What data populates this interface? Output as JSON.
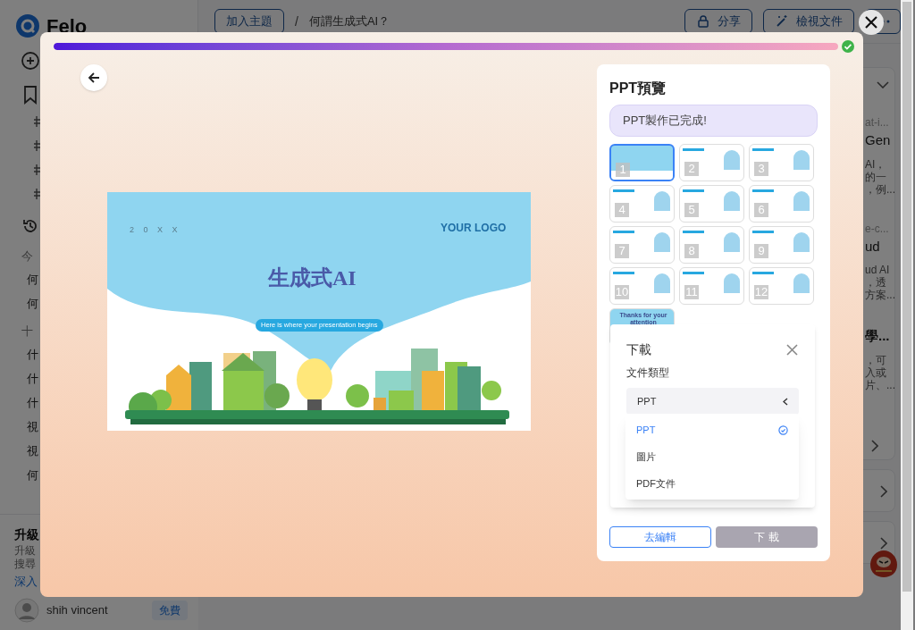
{
  "background_app": {
    "sidebar": {
      "brand": "Felo",
      "history_groups": [
        {
          "label": "今",
          "items": [
            "何",
            "何"
          ]
        },
        {
          "label": "十",
          "items": [
            "什",
            "什",
            "什",
            "視",
            "視",
            "何"
          ]
        }
      ],
      "upgrade": {
        "title": "升級",
        "lines": [
          "升級",
          "搜尋"
        ],
        "link": "深入"
      },
      "user": {
        "name": "shih vincent",
        "plan": "免費"
      }
    },
    "top_bar": {
      "add_topic": "加入主題",
      "separator": "/",
      "title": "何謂生成式AI？",
      "actions": [
        {
          "kind": "lock",
          "label": "分享"
        },
        {
          "kind": "wand",
          "label": "檢視文件"
        }
      ]
    },
    "results": [
      {
        "url": "at-i...",
        "title": "Gen",
        "snippet": [
          "AI，",
          "的一",
          "，例..."
        ]
      },
      {
        "url": "e-c...",
        "title": "ud",
        "snippet": [
          "ud AI",
          "，透",
          "方案..."
        ]
      },
      {
        "title": "學...",
        "snippet": [
          "，可",
          "入或",
          "片、..."
        ]
      }
    ]
  },
  "modal": {
    "progress": {
      "level": 1
    },
    "slide": {
      "date": "2 0 X X",
      "logo": "YOUR LOGO",
      "title": "生成式AI",
      "subtitle": "Here is where your presentation begins"
    },
    "preview": {
      "title": "PPT預覽",
      "notice": "PPT製作已完成!",
      "thumbnails": [
        {
          "kind": "cover",
          "number": "1",
          "selected": true
        },
        {
          "kind": "content",
          "number": "2",
          "selected": false
        },
        {
          "kind": "content",
          "number": "3",
          "selected": false
        },
        {
          "kind": "content",
          "number": "4",
          "selected": false
        },
        {
          "kind": "content",
          "number": "5",
          "selected": false
        },
        {
          "kind": "content",
          "number": "6",
          "selected": false
        },
        {
          "kind": "content",
          "number": "7",
          "selected": false
        },
        {
          "kind": "content",
          "number": "8",
          "selected": false
        },
        {
          "kind": "content",
          "number": "9",
          "selected": false
        },
        {
          "kind": "content",
          "number": "10",
          "selected": false
        },
        {
          "kind": "content",
          "number": "11",
          "selected": false
        },
        {
          "kind": "content",
          "number": "12",
          "selected": false
        },
        {
          "kind": "cover",
          "caption": "Thanks for your attention",
          "selected": false
        }
      ],
      "download": {
        "title": "下載",
        "field_label": "文件類型",
        "value": "PPT",
        "options": [
          {
            "label": "PPT",
            "selected": true
          },
          {
            "label": "圖片",
            "selected": false
          },
          {
            "label": "PDF文件",
            "selected": false
          }
        ]
      },
      "buttons": [
        {
          "kind": "outline",
          "label": "去編輯"
        },
        {
          "kind": "disabled",
          "label": "下 載"
        }
      ]
    }
  }
}
